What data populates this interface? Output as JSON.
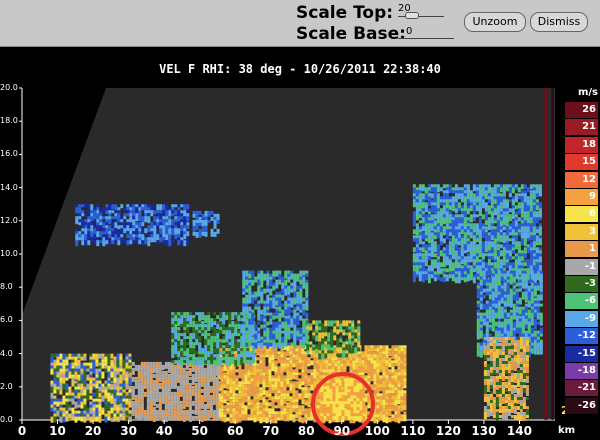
{
  "toolbar": {
    "scale_top_label": "Scale Top:",
    "scale_top_value": "20",
    "scale_base_label": "Scale Base:",
    "scale_base_value": "0",
    "unzoom_label": "Unzoom",
    "dismiss_label": "Dismiss"
  },
  "plot": {
    "title": "VEL F  RHI: 38 deg  -  10/26/2011 22:38:40",
    "x_unit": "km",
    "legend_unit": "m/s",
    "corner_digit": "2"
  },
  "chart_data": {
    "type": "heatmap",
    "title": "VEL F  RHI: 38 deg  -  10/26/2011 22:38:40",
    "xlabel": "km",
    "ylabel": "",
    "xlim": [
      0,
      150
    ],
    "ylim": [
      0,
      20
    ],
    "x_ticks": [
      "0",
      "10",
      "20",
      "30",
      "40",
      "50",
      "60",
      "70",
      "80",
      "90",
      "100",
      "110",
      "120",
      "130",
      "140"
    ],
    "y_ticks": [
      "0.0",
      "2.0",
      "4.0",
      "6.0",
      "8.0",
      "10.0",
      "12.0",
      "14.0",
      "16.0",
      "18.0",
      "20.0"
    ],
    "legend": [
      {
        "label": "26",
        "color": "#6b0f1a"
      },
      {
        "label": "21",
        "color": "#9b1b24"
      },
      {
        "label": "18",
        "color": "#c0252a"
      },
      {
        "label": "15",
        "color": "#e03a2e"
      },
      {
        "label": "12",
        "color": "#f06a3a"
      },
      {
        "label": "9",
        "color": "#f5a040"
      },
      {
        "label": "6",
        "color": "#f7e34a"
      },
      {
        "label": "3",
        "color": "#f2c13a"
      },
      {
        "label": "1",
        "color": "#e89a4a"
      },
      {
        "label": "-1",
        "color": "#a8a8a8"
      },
      {
        "label": "-3",
        "color": "#2f6a1f"
      },
      {
        "label": "-6",
        "color": "#4fc27a"
      },
      {
        "label": "-9",
        "color": "#5aa8e8"
      },
      {
        "label": "-12",
        "color": "#2b5ed8"
      },
      {
        "label": "-15",
        "color": "#1a2aa0"
      },
      {
        "label": "-18",
        "color": "#7a3aa8"
      },
      {
        "label": "-21",
        "color": "#6a1a3a"
      },
      {
        "label": "-26",
        "color": "#2a0a14"
      }
    ],
    "annotation": "red circle marking the region near 90 km, 0-2 km height"
  }
}
